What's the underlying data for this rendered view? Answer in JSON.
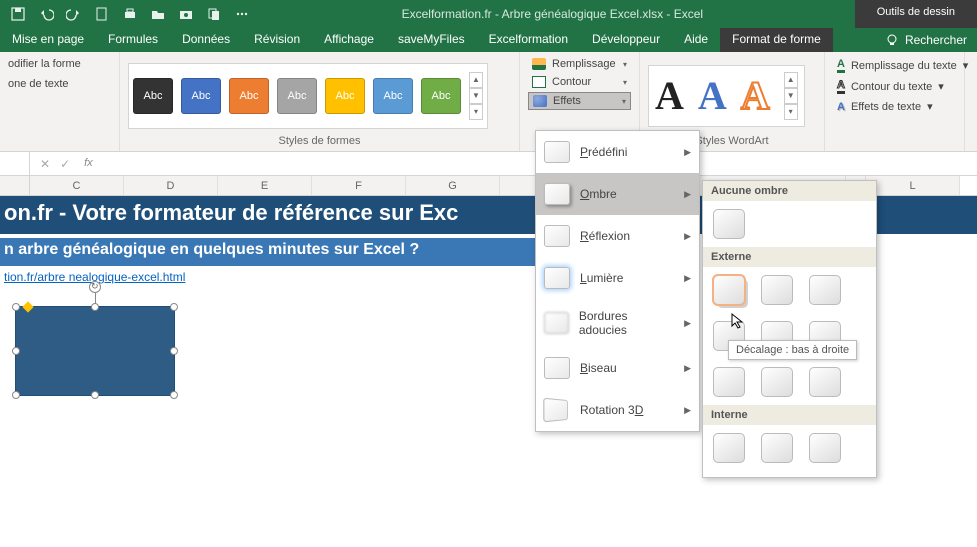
{
  "app": {
    "title": "Excelformation.fr - Arbre généalogique Excel.xlsx - Excel",
    "tools_tab": "Outils de dessin"
  },
  "tabs": {
    "layout": "Mise en page",
    "formulas": "Formules",
    "data": "Données",
    "review": "Révision",
    "view": "Affichage",
    "savemyfiles": "saveMyFiles",
    "excelformation": "Excelformation",
    "developer": "Développeur",
    "help": "Aide",
    "format": "Format de forme",
    "search": "Rechercher"
  },
  "ribbon": {
    "edit_shape": "odifier la forme",
    "text_box": "one de texte",
    "swatch_label": "Abc",
    "styles_label": "Styles de formes",
    "fill": "Remplissage",
    "outline": "Contour",
    "effects": "Effets",
    "wordart_label": "Styles WordArt",
    "wa_letter": "A",
    "text_fill": "Remplissage du texte",
    "text_outline": "Contour du texte",
    "text_effects": "Effets de texte"
  },
  "formula_bar": {
    "fx": "fx"
  },
  "columns": [
    "C",
    "D",
    "E",
    "F",
    "G",
    "",
    "",
    "",
    "L"
  ],
  "sheet": {
    "banner1": "on.fr - Votre formateur de référence sur Exc",
    "banner2": "n arbre généalogique en quelques minutes sur Excel ?",
    "link": "tion.fr/arbre    nealogique-excel.html"
  },
  "fxmenu": {
    "preset": "Prédéfini",
    "shadow": "Ombre",
    "reflection": "Réflexion",
    "glow": "Lumière",
    "softedges": "Bordures adoucies",
    "bevel": "Biseau",
    "rotation3d": "Rotation 3D"
  },
  "shadowmenu": {
    "none": "Aucune ombre",
    "outer": "Externe",
    "inner": "Interne",
    "tooltip": "Décalage : bas à droite"
  }
}
